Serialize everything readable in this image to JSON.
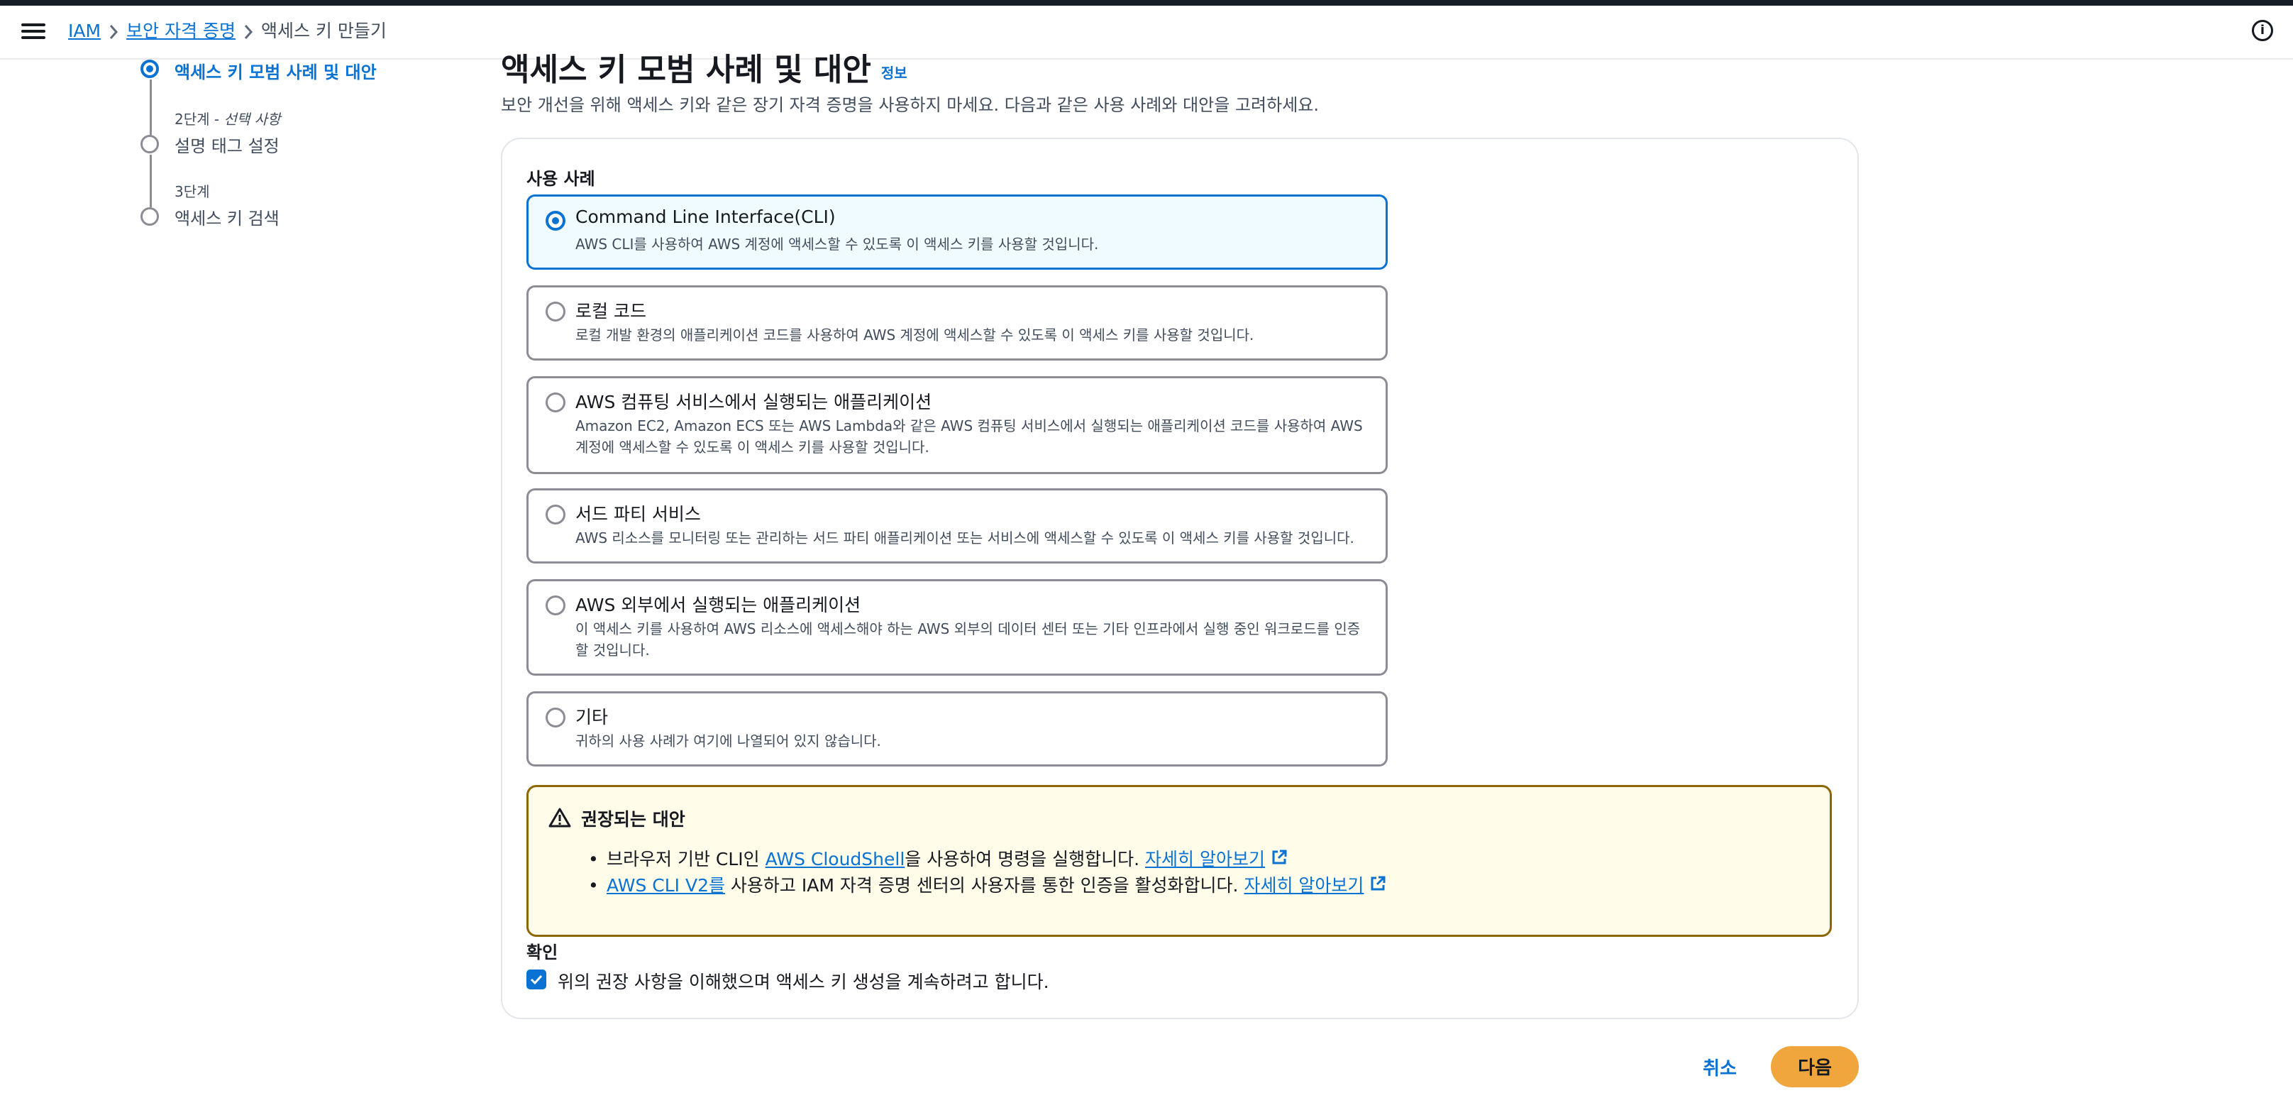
{
  "breadcrumb": {
    "items": [
      {
        "label": "IAM"
      },
      {
        "label": "보안 자격 증명"
      },
      {
        "label": "액세스 키 만들기"
      }
    ]
  },
  "steps": [
    {
      "title": "액세스 키 모범 사례 및 대안",
      "status": "current"
    },
    {
      "step_label": "2단계 - ",
      "optional": "선택 사항",
      "title": "설명 태그 설정",
      "status": "upcoming"
    },
    {
      "step_label": "3단계",
      "title": "액세스 키 검색",
      "status": "upcoming"
    }
  ],
  "header": {
    "title": "액세스 키 모범 사례 및 대안",
    "info_link": "정보",
    "description": "보안 개선을 위해 액세스 키와 같은 장기 자격 증명을 사용하지 마세요. 다음과 같은 사용 사례와 대안을 고려하세요."
  },
  "use_cases": {
    "label": "사용 사례",
    "selected_index": 0,
    "options": [
      {
        "title": "Command Line Interface(CLI)",
        "description": "AWS CLI를 사용하여 AWS 계정에 액세스할 수 있도록 이 액세스 키를 사용할 것입니다."
      },
      {
        "title": "로컬 코드",
        "description": "로컬 개발 환경의 애플리케이션 코드를 사용하여 AWS 계정에 액세스할 수 있도록 이 액세스 키를 사용할 것입니다."
      },
      {
        "title": "AWS 컴퓨팅 서비스에서 실행되는 애플리케이션",
        "description": "Amazon EC2, Amazon ECS 또는 AWS Lambda와 같은 AWS 컴퓨팅 서비스에서 실행되는 애플리케이션 코드를 사용하여 AWS 계정에 액세스할 수 있도록 이 액세스 키를 사용할 것입니다."
      },
      {
        "title": "서드 파티 서비스",
        "description": "AWS 리소스를 모니터링 또는 관리하는 서드 파티 애플리케이션 또는 서비스에 액세스할 수 있도록 이 액세스 키를 사용할 것입니다."
      },
      {
        "title": "AWS 외부에서 실행되는 애플리케이션",
        "description": "이 액세스 키를 사용하여 AWS 리소스에 액세스해야 하는 AWS 외부의 데이터 센터 또는 기타 인프라에서 실행 중인 워크로드를 인증할 것입니다."
      },
      {
        "title": "기타",
        "description": "귀하의 사용 사례가 여기에 나열되어 있지 않습니다."
      }
    ]
  },
  "alert": {
    "title": "권장되는 대안",
    "item1": {
      "prefix": "브라우저 기반 CLI인 ",
      "link": "AWS CloudShell",
      "suffix": "을 사용하여 명령을 실행합니다. ",
      "learn_more": "자세히 알아보기"
    },
    "item2": {
      "link": "AWS CLI V2를",
      "suffix": " 사용하고 IAM 자격 증명 센터의 사용자를 통한 인증을 활성화합니다. ",
      "learn_more": "자세히 알아보기"
    }
  },
  "confirmation": {
    "label": "확인",
    "checkbox_text": "위의 권장 사항을 이해했으며 액세스 키 생성을 계속하려고 합니다.",
    "checked": true
  },
  "footer": {
    "cancel": "취소",
    "next": "다음"
  },
  "colors": {
    "accent": "#0972d3",
    "primary_button": "#f0a63c",
    "warning_border": "#8d6605",
    "warning_bg": "#fffce9",
    "selected_tile_bg": "#f0fbff"
  }
}
